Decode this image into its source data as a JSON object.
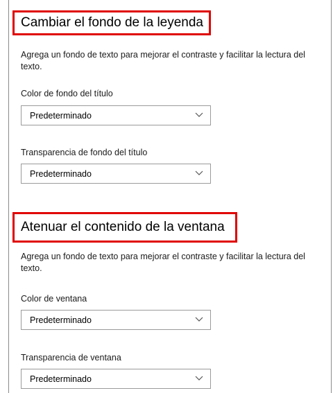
{
  "section1": {
    "title": "Cambiar el fondo de la leyenda",
    "description": "Agrega un fondo de texto para mejorar el contraste y facilitar la lectura del texto.",
    "field1": {
      "label": "Color de fondo del título",
      "value": "Predeterminado"
    },
    "field2": {
      "label": "Transparencia de fondo del título",
      "value": "Predeterminado"
    }
  },
  "section2": {
    "title": "Atenuar el contenido de la ventana",
    "description": "Agrega un fondo de texto para mejorar el contraste y facilitar la lectura del texto.",
    "field1": {
      "label": "Color de ventana",
      "value": "Predeterminado"
    },
    "field2": {
      "label": "Transparencia de ventana",
      "value": "Predeterminado"
    }
  },
  "icons": {
    "dropdown": "chevron-down-icon"
  },
  "colors": {
    "highlight": "#e00000",
    "border": "#9a9a9a"
  }
}
